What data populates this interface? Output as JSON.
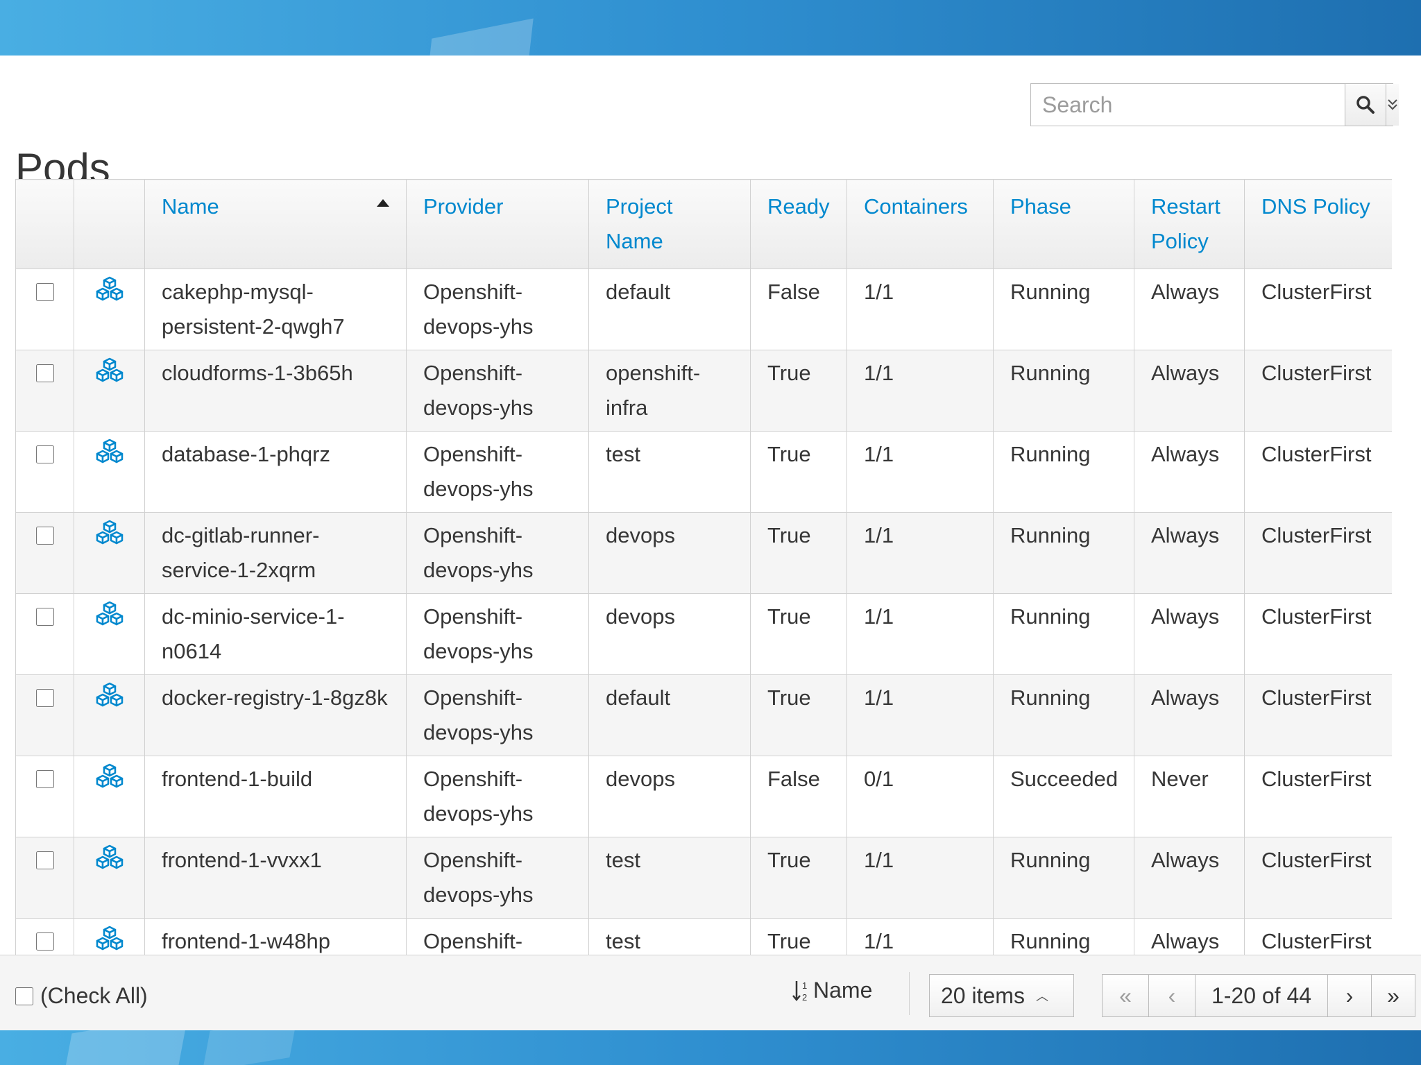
{
  "page": {
    "title": "Pods"
  },
  "search": {
    "placeholder": "Search"
  },
  "colors": {
    "accent": "#0088ce",
    "banner": "#2f8fd0"
  },
  "table": {
    "columns": [
      "",
      "",
      "Name",
      "Provider",
      "Project Name",
      "Ready",
      "Containers",
      "Phase",
      "Restart Policy",
      "DNS Policy"
    ],
    "sorted_column": "Name",
    "sort_direction": "ascending",
    "row_icon": "pod-cubes-icon",
    "rows": [
      {
        "name": "cakephp-mysql-persistent-2-qwgh7",
        "provider": "Openshift-devops-yhs",
        "project": "default",
        "ready": "False",
        "containers": "1/1",
        "phase": "Running",
        "restart": "Always",
        "dns": "ClusterFirst"
      },
      {
        "name": "cloudforms-1-3b65h",
        "provider": "Openshift-devops-yhs",
        "project": "openshift-infra",
        "ready": "True",
        "containers": "1/1",
        "phase": "Running",
        "restart": "Always",
        "dns": "ClusterFirst"
      },
      {
        "name": "database-1-phqrz",
        "provider": "Openshift-devops-yhs",
        "project": "test",
        "ready": "True",
        "containers": "1/1",
        "phase": "Running",
        "restart": "Always",
        "dns": "ClusterFirst"
      },
      {
        "name": "dc-gitlab-runner-service-1-2xqrm",
        "provider": "Openshift-devops-yhs",
        "project": "devops",
        "ready": "True",
        "containers": "1/1",
        "phase": "Running",
        "restart": "Always",
        "dns": "ClusterFirst"
      },
      {
        "name": "dc-minio-service-1-n0614",
        "provider": "Openshift-devops-yhs",
        "project": "devops",
        "ready": "True",
        "containers": "1/1",
        "phase": "Running",
        "restart": "Always",
        "dns": "ClusterFirst"
      },
      {
        "name": "docker-registry-1-8gz8k",
        "provider": "Openshift-devops-yhs",
        "project": "default",
        "ready": "True",
        "containers": "1/1",
        "phase": "Running",
        "restart": "Always",
        "dns": "ClusterFirst"
      },
      {
        "name": "frontend-1-build",
        "provider": "Openshift-devops-yhs",
        "project": "devops",
        "ready": "False",
        "containers": "0/1",
        "phase": "Succeeded",
        "restart": "Never",
        "dns": "ClusterFirst"
      },
      {
        "name": "frontend-1-vvxx1",
        "provider": "Openshift-devops-yhs",
        "project": "test",
        "ready": "True",
        "containers": "1/1",
        "phase": "Running",
        "restart": "Always",
        "dns": "ClusterFirst"
      },
      {
        "name": "frontend-1-w48hp",
        "provider": "Openshift-devops-yhs",
        "project": "test",
        "ready": "True",
        "containers": "1/1",
        "phase": "Running",
        "restart": "Always",
        "dns": "ClusterFirst"
      }
    ]
  },
  "footer": {
    "check_all_label": "(Check All)",
    "sort_label": "Name",
    "per_page_label": "20 items",
    "range_label": "1-20 of 44",
    "first_icon": "«",
    "prev_icon": "‹",
    "next_icon": "›",
    "last_icon": "»"
  }
}
